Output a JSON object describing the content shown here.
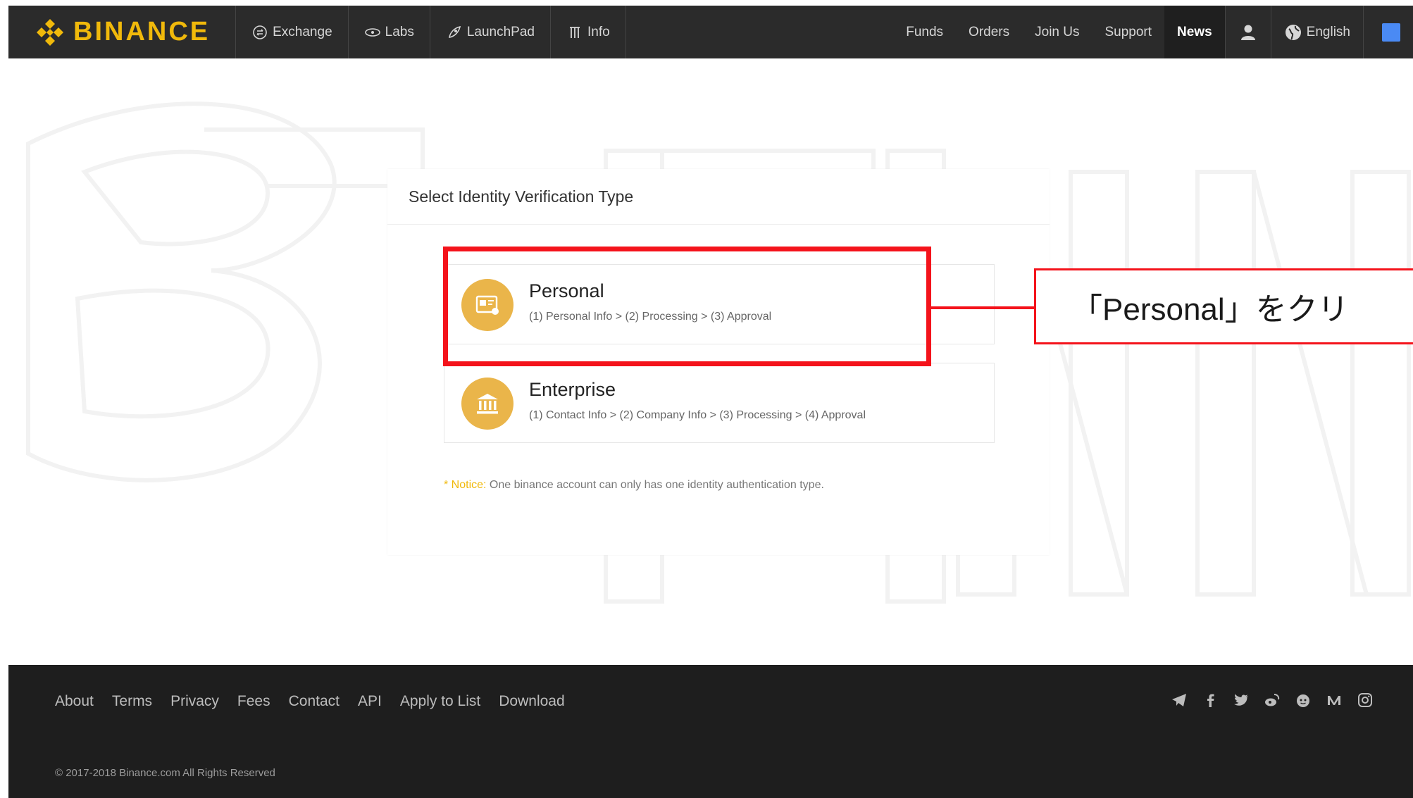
{
  "nav": {
    "brand": "BINANCE",
    "left_items": [
      {
        "label": "Exchange",
        "icon": "exchange-icon"
      },
      {
        "label": "Labs",
        "icon": "labs-icon"
      },
      {
        "label": "LaunchPad",
        "icon": "rocket-icon"
      },
      {
        "label": "Info",
        "icon": "info-icon"
      }
    ],
    "right_items": [
      {
        "label": "Funds"
      },
      {
        "label": "Orders"
      },
      {
        "label": "Join Us"
      },
      {
        "label": "Support"
      },
      {
        "label": "News",
        "active": true
      }
    ],
    "user_icon": "user-icon",
    "language": "English",
    "translate_icon": "translate-icon"
  },
  "card": {
    "title": "Select Identity Verification Type",
    "options": [
      {
        "title": "Personal",
        "steps": "(1) Personal Info > (2) Processing > (3) Approval",
        "icon": "id-card-icon"
      },
      {
        "title": "Enterprise",
        "steps": "(1) Contact Info > (2) Company Info > (3) Processing > (4) Approval",
        "icon": "bank-icon"
      }
    ],
    "notice_label": "* Notice:",
    "notice_text": "One binance account can only has one identity authentication type."
  },
  "annotation": {
    "callout": "「Personal」をクリ",
    "color": "#f4131b"
  },
  "footer": {
    "links": [
      "About",
      "Terms",
      "Privacy",
      "Fees",
      "Contact",
      "API",
      "Apply to List",
      "Download"
    ],
    "social_icons": [
      "telegram-icon",
      "facebook-icon",
      "twitter-icon",
      "weibo-icon",
      "reddit-icon",
      "medium-icon",
      "instagram-icon"
    ],
    "copyright": "© 2017-2018 Binance.com All Rights Reserved"
  },
  "colors": {
    "brand": "#f0b90b",
    "nav_bg": "#2b2b2b",
    "footer_bg": "#1e1e1e",
    "icon_circle": "#eab54a",
    "translate_blue": "#4a8af4"
  }
}
